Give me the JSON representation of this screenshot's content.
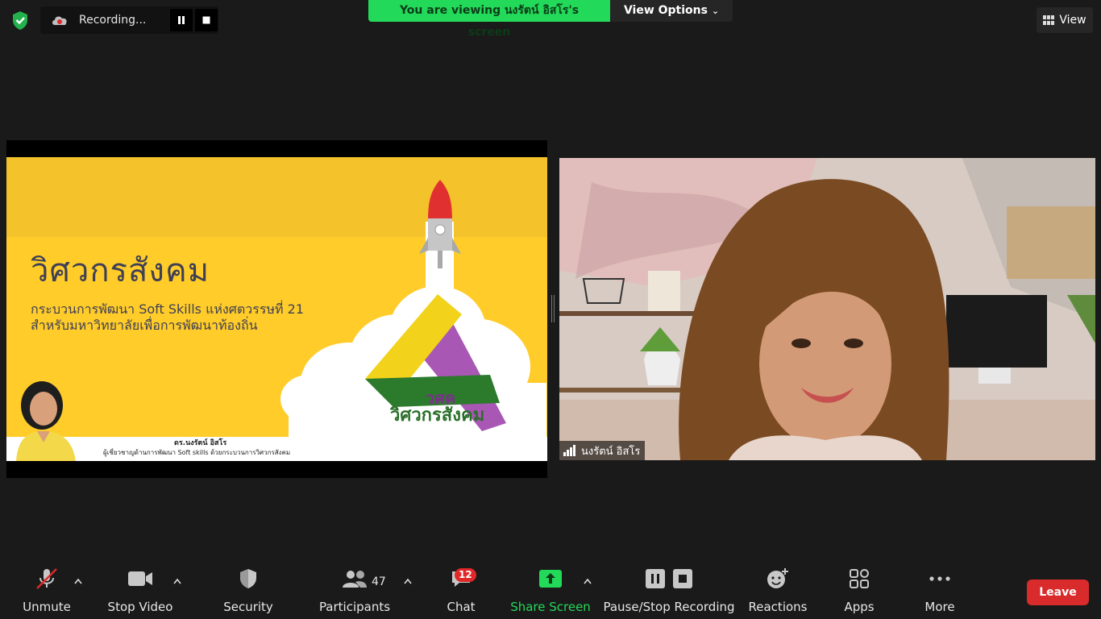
{
  "recording": {
    "status": "Recording..."
  },
  "viewing": {
    "banner": "You are viewing นงรัตน์ อิสโร's screen",
    "options": "View Options"
  },
  "view_button": {
    "label": "View"
  },
  "slide": {
    "title": "วิศวกรสังคม",
    "subtitle_line1": "กระบวนการพัฒนา Soft Skills แห่งศตวรรษที่ 21",
    "subtitle_line2": "สำหรับมหาวิทยาลัยเพื่อการพัฒนาท้องถิ่น",
    "presenter_name": "ดร.นงรัตน์ อิสโร",
    "presenter_role": "ผู้เชี่ยวชาญด้านการพัฒนา Soft skills ด้วยกระบวนการวิศวกรสังคม",
    "logo_abbr": "วศค",
    "logo_text": "วิศวกรสังคม"
  },
  "participant": {
    "name": "นงรัตน์ อิสโร"
  },
  "toolbar": {
    "unmute": "Unmute",
    "stop_video": "Stop Video",
    "security": "Security",
    "participants": "Participants",
    "participants_count": "47",
    "chat": "Chat",
    "chat_badge": "12",
    "share_screen": "Share Screen",
    "pause_stop_recording": "Pause/Stop Recording",
    "reactions": "Reactions",
    "apps": "Apps",
    "more": "More",
    "leave": "Leave"
  },
  "colors": {
    "accent_green": "#23d959",
    "leave_red": "#d92b2b",
    "badge_red": "#e02828"
  }
}
